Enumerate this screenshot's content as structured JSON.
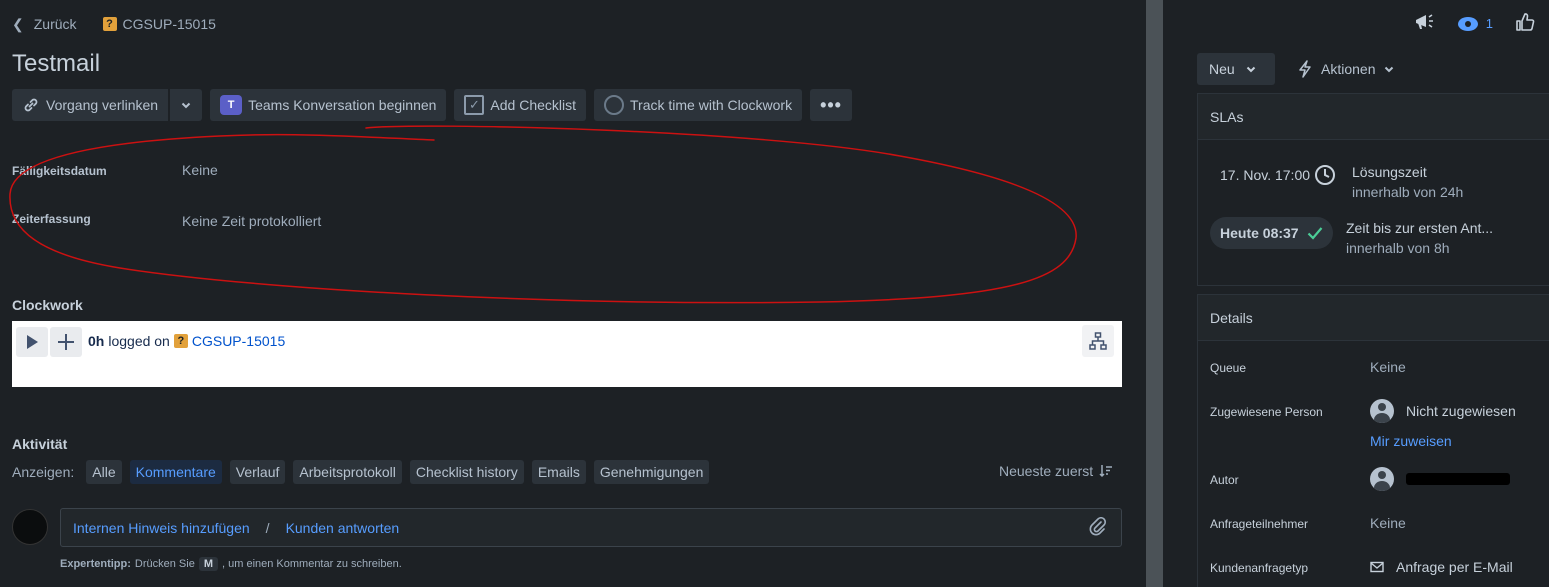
{
  "breadcrumb": {
    "back_label": "Zurück",
    "issue_key": "CGSUP-15015",
    "issue_type_glyph": "?"
  },
  "issue": {
    "title": "Testmail"
  },
  "toolbar": {
    "link_label": "Vorgang verlinken",
    "teams_label": "Teams Konversation beginnen",
    "teams_glyph": "T",
    "checklist_label": "Add Checklist",
    "clockwork_label": "Track time with Clockwork",
    "more_label": "•••"
  },
  "fields": [
    {
      "label": "Fälligkeitsdatum",
      "value": "Keine"
    },
    {
      "label": "Zeiterfassung",
      "value": "Keine Zeit protokolliert"
    }
  ],
  "clockwork": {
    "section_title": "Clockwork",
    "logged_hours": "0h",
    "logged_text": "logged on",
    "issue_link": "CGSUP-15015"
  },
  "activity": {
    "title": "Aktivität",
    "show_label": "Anzeigen:",
    "filters": [
      "Alle",
      "Kommentare",
      "Verlauf",
      "Arbeitsprotokoll",
      "Checklist history",
      "Emails",
      "Genehmigungen"
    ],
    "active_filter": "Kommentare",
    "sort_label": "Neueste zuerst"
  },
  "comment": {
    "internal_link": "Internen Hinweis hinzufügen",
    "separator": "/",
    "reply_link": "Kunden antworten",
    "tip_prefix": "Expertentipp:",
    "tip_mid": "Drücken Sie",
    "tip_key": "M",
    "tip_suffix": ", um einen Kommentar zu schreiben."
  },
  "sidebar": {
    "watchers_count": "1",
    "status": "Neu",
    "actions_label": "Aktionen",
    "sla_title": "SLAs",
    "slas": [
      {
        "time": "17. Nov. 17:00",
        "name": "Lösungszeit",
        "target": "innerhalb von 24h"
      },
      {
        "time": "Heute 08:37",
        "name": "Zeit bis zur ersten Ant...",
        "target": "innerhalb von 8h"
      }
    ],
    "details_title": "Details",
    "details": {
      "queue_label": "Queue",
      "queue_value": "Keine",
      "assignee_label": "Zugewiesene Person",
      "assignee_value": "Nicht zugewiesen",
      "assign_me": "Mir zuweisen",
      "author_label": "Autor",
      "participants_label": "Anfrageteilnehmer",
      "participants_value": "Keine",
      "request_type_label": "Kundenanfragetyp",
      "request_type_value": "Anfrage per E-Mail"
    }
  },
  "colors": {
    "background": "#1d2125",
    "accent": "#579dff",
    "annotation": "#cc1111",
    "success": "#4bce97"
  },
  "icons": [
    "chevron-left-icon",
    "link-icon",
    "chevron-down-icon",
    "teams-icon",
    "checkbox-icon",
    "clockwork-icon",
    "more-icon",
    "play-icon",
    "plus-icon",
    "hierarchy-icon",
    "sort-icon",
    "paperclip-icon",
    "megaphone-icon",
    "eye-icon",
    "thumbs-up-icon",
    "lightning-icon",
    "clock-icon",
    "check-icon",
    "person-icon",
    "mail-icon"
  ]
}
